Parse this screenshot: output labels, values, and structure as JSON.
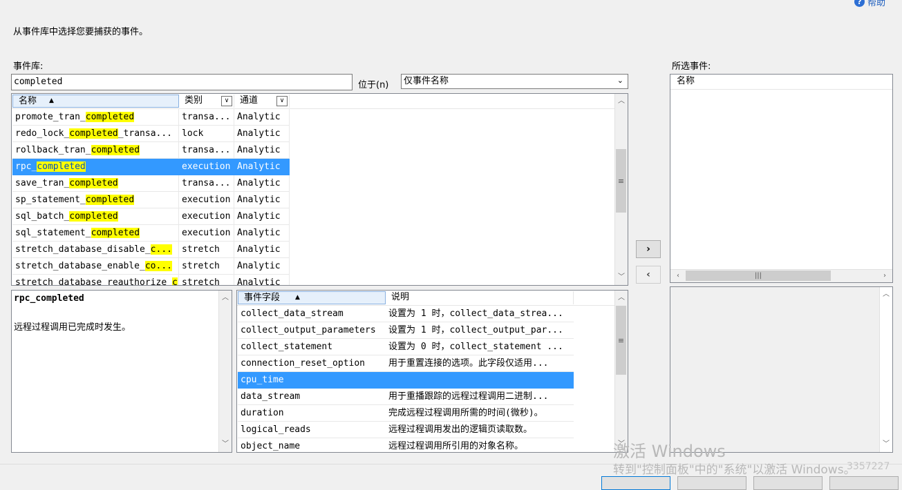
{
  "header": {
    "help_label": "帮助",
    "instruction": "从事件库中选择您要捕获的事件。"
  },
  "library": {
    "label": "事件库:",
    "search_value": "completed",
    "position_label": "位于(n)",
    "scope_selected": "仅事件名称",
    "columns": {
      "name": "名称",
      "category": "类别",
      "channel": "通道"
    },
    "rows": [
      {
        "pre": "promote_tran_",
        "match": "completed",
        "post": "",
        "category": "transa...",
        "channel": "Analytic"
      },
      {
        "pre": "redo_lock_",
        "match": "completed",
        "post": "_transa...",
        "category": "lock",
        "channel": "Analytic"
      },
      {
        "pre": "rollback_tran_",
        "match": "completed",
        "post": "",
        "category": "transa...",
        "channel": "Analytic"
      },
      {
        "pre": "rpc_",
        "match": "completed",
        "post": "",
        "category": "execution",
        "channel": "Analytic"
      },
      {
        "pre": "save_tran_",
        "match": "completed",
        "post": "",
        "category": "transa...",
        "channel": "Analytic"
      },
      {
        "pre": "sp_statement_",
        "match": "completed",
        "post": "",
        "category": "execution",
        "channel": "Analytic"
      },
      {
        "pre": "sql_batch_",
        "match": "completed",
        "post": "",
        "category": "execution",
        "channel": "Analytic"
      },
      {
        "pre": "sql_statement_",
        "match": "completed",
        "post": "",
        "category": "execution",
        "channel": "Analytic"
      },
      {
        "pre": "stretch_database_disable_",
        "match": "c...",
        "post": "",
        "category": "stretch",
        "channel": "Analytic"
      },
      {
        "pre": "stretch_database_enable_",
        "match": "co...",
        "post": "",
        "category": "stretch",
        "channel": "Analytic"
      },
      {
        "pre": "stretch_database_reauthorize_",
        "match": "c",
        "post": "",
        "category": "stretch",
        "channel": "Analytic"
      }
    ],
    "selected_index": 3
  },
  "details": {
    "event_name": "rpc_completed",
    "description": "远程过程调用已完成时发生。"
  },
  "fields": {
    "columns": {
      "field": "事件字段",
      "desc": "说明"
    },
    "rows": [
      {
        "name": "collect_data_stream",
        "desc": "设置为 1 时，collect_data_strea..."
      },
      {
        "name": "collect_output_parameters",
        "desc": "设置为 1 时，collect_output_par..."
      },
      {
        "name": "collect_statement",
        "desc": "设置为 0 时，collect_statement ..."
      },
      {
        "name": "connection_reset_option",
        "desc": "用于重置连接的选项。此字段仅适用..."
      },
      {
        "name": "cpu_time",
        "desc": ""
      },
      {
        "name": "data_stream",
        "desc": "用于重播跟踪的远程过程调用二进制..."
      },
      {
        "name": "duration",
        "desc": "完成远程过程调用所需的时间(微秒)。"
      },
      {
        "name": "logical_reads",
        "desc": "远程过程调用发出的逻辑页读取数。"
      },
      {
        "name": "object_name",
        "desc": "远程过程调用所引用的对象名称。"
      }
    ],
    "selected_index": 4
  },
  "selected": {
    "label": "所选事件:",
    "column_name": "名称"
  },
  "buttons": {
    "add": "›",
    "remove": "‹"
  },
  "watermark": {
    "line1": "激活 Windows",
    "line2": "转到\"控制面板\"中的\"系统\"以激活 Windows。",
    "line3": "3357227"
  }
}
